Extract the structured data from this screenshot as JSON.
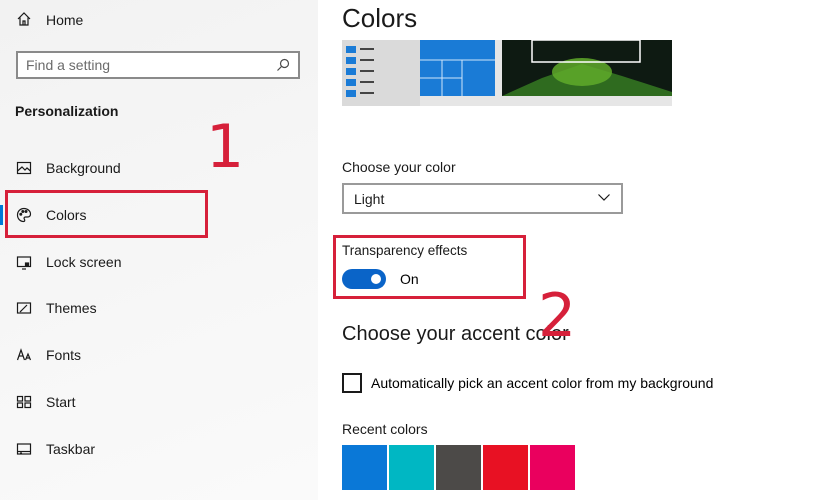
{
  "sidebar": {
    "home": {
      "label": "Home",
      "icon": "home-icon"
    },
    "search": {
      "placeholder": "Find a setting",
      "value": "",
      "icon": "search-icon"
    },
    "section_title": "Personalization",
    "items": [
      {
        "label": "Background",
        "icon": "background-icon",
        "active": false
      },
      {
        "label": "Colors",
        "icon": "palette-icon",
        "active": true
      },
      {
        "label": "Lock screen",
        "icon": "lock-screen-icon",
        "active": false
      },
      {
        "label": "Themes",
        "icon": "themes-icon",
        "active": false
      },
      {
        "label": "Fonts",
        "icon": "fonts-icon",
        "active": false
      },
      {
        "label": "Start",
        "icon": "start-icon",
        "active": false
      },
      {
        "label": "Taskbar",
        "icon": "taskbar-icon",
        "active": false
      }
    ]
  },
  "annotations": {
    "one": "1",
    "two": "2",
    "color": "#d6203a"
  },
  "main": {
    "title": "Colors",
    "choose_color": {
      "label": "Choose your color",
      "value": "Light"
    },
    "transparency": {
      "label": "Transparency effects",
      "state": "On",
      "on": true
    },
    "accent": {
      "heading": "Choose your accent color",
      "auto_pick_label": "Automatically pick an accent color from my background",
      "auto_pick_checked": false,
      "recent_label": "Recent colors",
      "recent_colors": [
        "#0a78d7",
        "#00b7c3",
        "#4c4a48",
        "#e81123",
        "#ea005e"
      ]
    },
    "accent_color": "#0a64c8"
  }
}
